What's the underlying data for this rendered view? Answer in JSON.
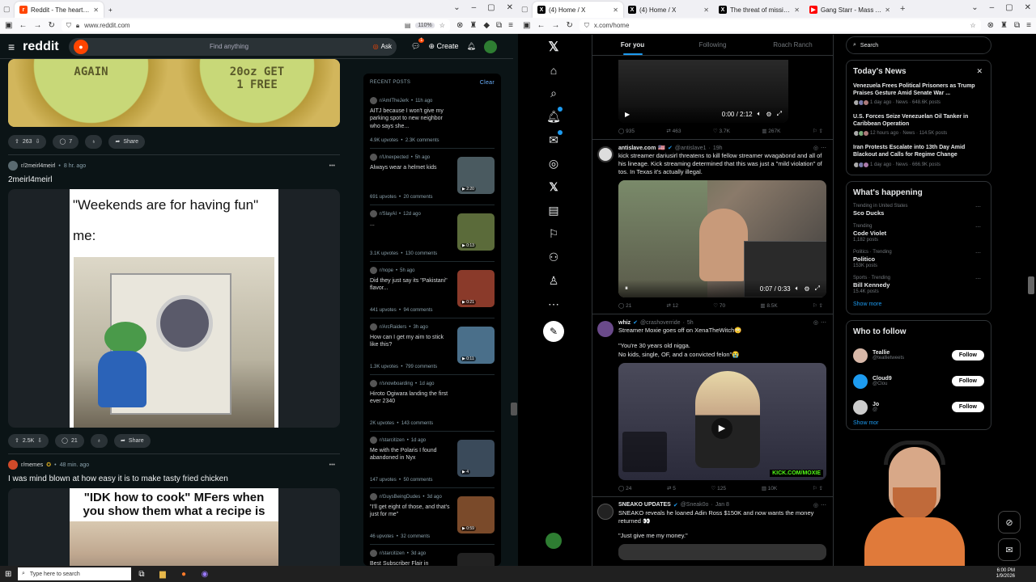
{
  "left_browser": {
    "tabs": [
      {
        "label": "Reddit - The heart of the interne",
        "active": true
      },
      {
        "label": "+"
      }
    ],
    "url": "www.reddit.com",
    "zoom": "110%"
  },
  "reddit": {
    "brand": "reddit",
    "search_placeholder": "Find anything",
    "ask_label": "Ask",
    "create_label": "Create",
    "chat_badge": "1",
    "posts": [
      {
        "caps_left": "AGAIN",
        "caps_right_1": "20oz GET",
        "caps_right_2": "1 FREE",
        "votes": "263",
        "comments": "7",
        "share": "Share"
      },
      {
        "subreddit": "r/2meirl4meirl",
        "age": "8 hr. ago",
        "title": "2meirl4meirl",
        "meme_line1": "\"Weekends are for having fun\"",
        "meme_line2": "me:",
        "votes": "2.5K",
        "comments": "21",
        "share": "Share"
      },
      {
        "subreddit": "r/memes",
        "age": "48 min. ago",
        "title": "I was mind blown at how easy it is to make tasty fried chicken",
        "meme_text": "\"IDK how to cook\" MFers when you show them what a recipe is"
      }
    ],
    "recent": {
      "heading": "RECENT POSTS",
      "clear": "Clear",
      "items": [
        {
          "sub": "r/AmITheJerk",
          "age": "11h ago",
          "title": "AITJ because I won't give my parking spot to new neighbor who says she...",
          "upvotes": "4.9K upvotes",
          "comments": "2.3K comments",
          "thumb": "",
          "dur": ""
        },
        {
          "sub": "r/Unexpected",
          "age": "5h ago",
          "title": "Always wear a helmet kids",
          "upvotes": "691 upvotes",
          "comments": "20 comments",
          "thumb": "#4a5a60",
          "dur": "2:20"
        },
        {
          "sub": "r/SlayAI",
          "age": "12d ago",
          "title": "...",
          "upvotes": "3.1K upvotes",
          "comments": "130 comments",
          "thumb": "#5b6b3a",
          "dur": "0:13"
        },
        {
          "sub": "r/nope",
          "age": "5h ago",
          "title": "Did they just say its \"Pakistani\" flavor...",
          "upvotes": "441 upvotes",
          "comments": "94 comments",
          "thumb": "#8a3a2a",
          "dur": "0:21"
        },
        {
          "sub": "r/ArcRaiders",
          "age": "3h ago",
          "title": "How can I get my aim to stick like this?",
          "upvotes": "1.3K upvotes",
          "comments": "799 comments",
          "thumb": "#4a6f8a",
          "dur": "0:11"
        },
        {
          "sub": "r/snowboarding",
          "age": "1d ago",
          "title": "Hiroto Ogiwara landing the first ever 2340",
          "upvotes": "2K upvotes",
          "comments": "143 comments",
          "thumb": "",
          "dur": ""
        },
        {
          "sub": "r/starcitizen",
          "age": "1d ago",
          "title": "Me with the Polaris I found abandoned in Nyx",
          "upvotes": "147 upvotes",
          "comments": "50 comments",
          "thumb": "#3a4a5a",
          "dur": "4"
        },
        {
          "sub": "r/GuysBeingDudes",
          "age": "3d ago",
          "title": "\"I'll get eight of those, and that's just for me\"",
          "upvotes": "46 upvotes",
          "comments": "32 comments",
          "thumb": "#7a4a2a",
          "dur": "0:59"
        },
        {
          "sub": "r/starcitizen",
          "age": "3d ago",
          "title": "Best Subscriber Flair in",
          "upvotes": "",
          "comments": "",
          "thumb": "#222",
          "dur": ""
        }
      ]
    }
  },
  "right_browser": {
    "tabs": [
      {
        "label": "(4) Home / X",
        "active": true
      },
      {
        "label": "(4) Home / X"
      },
      {
        "label": "The threat of missiles and"
      },
      {
        "label": "Gang Starr - Mass Appeal - You"
      }
    ],
    "url": "x.com/home"
  },
  "x": {
    "tabs": [
      "For you",
      "Following",
      "Roach Ranch"
    ],
    "tweets": [
      {
        "video_time": "0:00 / 2:12",
        "replies": "935",
        "reposts": "463",
        "likes": "3.7K",
        "views": "267K"
      },
      {
        "name": "antislave.com",
        "flag": "🇺🇸",
        "handle": "@antislave1",
        "age": "19h",
        "text": "kick streamer dariusirl threatens to kill fellow streamer wvagabond and all of his lineage. Kick streaming determined that this was just a \"mild violation\" of tos. In Texas it's actually illegal.",
        "video_time": "0:07 / 0:33",
        "replies": "21",
        "reposts": "12",
        "likes": "70",
        "views": "8.5K"
      },
      {
        "name": "whiz",
        "handle": "@crashoverride",
        "age": "5h",
        "text1": "Streamer Moxie goes off on XenaTheWitch😳",
        "text2": "\"You're 30 years old nigga.",
        "text3": "No kids, single, OF, and a convicted felon\"😭",
        "overlay": "KICK.COM/MOXIE",
        "replies": "24",
        "reposts": "5",
        "likes": "125",
        "views": "10K"
      },
      {
        "name": "SNEAKO UPDATES",
        "handle": "@Sneak0o",
        "age": "Jan 8",
        "text1": "SNEAKO reveals he loaned Adin Ross $150K and now wants the money returned 👀",
        "text2": "\"Just give me my money.\""
      }
    ],
    "search_placeholder": "Search",
    "news": {
      "title": "Today's News",
      "items": [
        {
          "title": "Venezuela Frees Political Prisoners as Trump Praises Gesture Amid Senate War ...",
          "meta": "1 day ago · News · 648.6K posts"
        },
        {
          "title": "U.S. Forces Seize Venezuelan Oil Tanker in Caribbean Operation",
          "meta": "12 hours ago · News · 114.5K posts"
        },
        {
          "title": "Iran Protests Escalate into 13th Day Amid Blackout and Calls for Regime Change",
          "meta": "1 day ago · News · 666.9K posts"
        }
      ]
    },
    "happening": {
      "title": "What's happening",
      "items": [
        {
          "context": "Trending in United States",
          "name": "Sco Ducks",
          "posts": ""
        },
        {
          "context": "Trending",
          "name": "Code Violet",
          "posts": "1,182 posts"
        },
        {
          "context": "Politics · Trending",
          "name": "Politico",
          "posts": "153K posts"
        },
        {
          "context": "Sports · Trending",
          "name": "Bill Kennedy",
          "posts": "15.4K posts"
        }
      ],
      "show_more": "Show more"
    },
    "follow": {
      "title": "Who to follow",
      "items": [
        {
          "name": "Teallie",
          "handle": "@teallietweets",
          "button": "Follow"
        },
        {
          "name": "Cloud9",
          "handle": "@Clou",
          "button": "Follow"
        },
        {
          "name": "Jo",
          "handle": "@",
          "button": "Follow"
        }
      ],
      "show_more": "Show mor"
    }
  },
  "taskbar": {
    "search_placeholder": "Type here to search",
    "time": "6:00 PM",
    "date": "1/9/2026"
  }
}
